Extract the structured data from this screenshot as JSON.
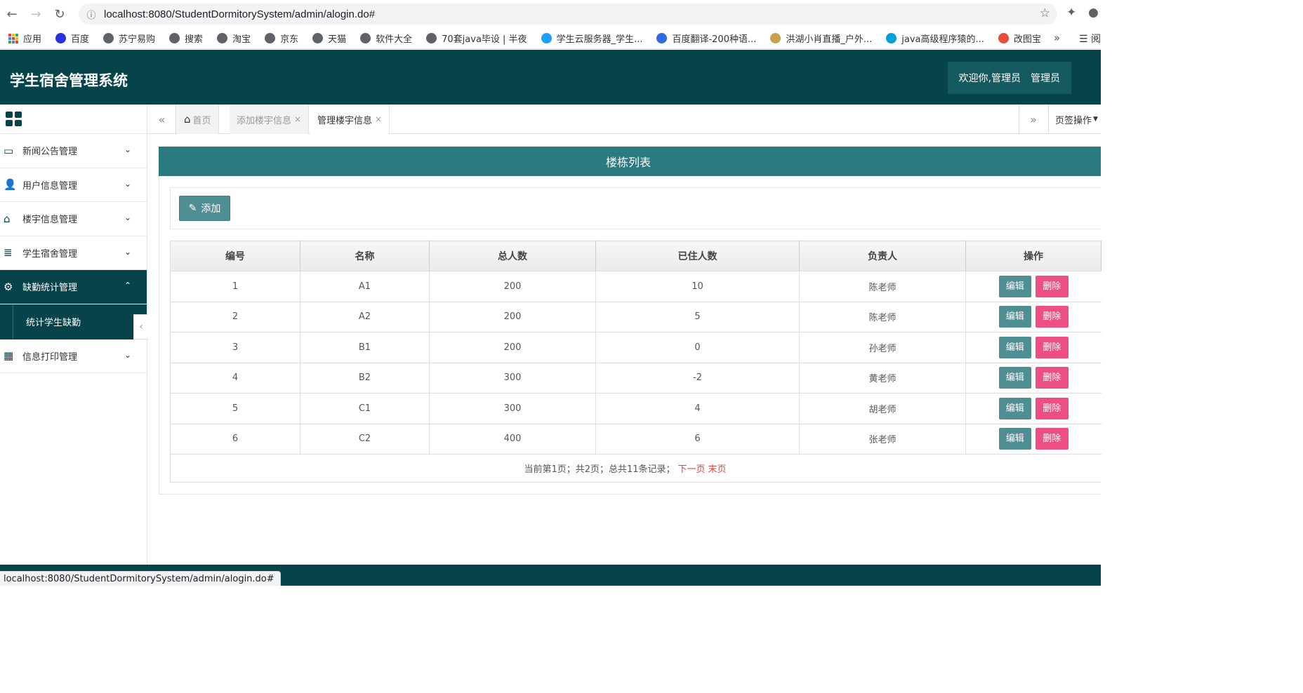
{
  "browser": {
    "url": "localhost:8080/StudentDormitorySystem/admin/alogin.do#",
    "status_url": "localhost:8080/StudentDormitorySystem/admin/alogin.do#",
    "bookmarks": [
      {
        "label": "应用",
        "color": "#4285f4"
      },
      {
        "label": "百度",
        "color": "#2932e1"
      },
      {
        "label": "苏宁易购",
        "color": "#5f6368"
      },
      {
        "label": "搜索",
        "color": "#5f6368"
      },
      {
        "label": "淘宝",
        "color": "#5f6368"
      },
      {
        "label": "京东",
        "color": "#5f6368"
      },
      {
        "label": "天猫",
        "color": "#5f6368"
      },
      {
        "label": "软件大全",
        "color": "#5f6368"
      },
      {
        "label": "70套java毕设 | 半夜",
        "color": "#5f6368"
      },
      {
        "label": "学生云服务器_学生...",
        "color": "#1e9fff"
      },
      {
        "label": "百度翻译-200种语...",
        "color": "#2f6ae0"
      },
      {
        "label": "洪湖小肖直播_户外...",
        "color": "#c8a24a"
      },
      {
        "label": "java高级程序猿的...",
        "color": "#00a1d6"
      },
      {
        "label": "改图宝",
        "color": "#e84c3d"
      }
    ],
    "bookmarks_more": "»",
    "reading_list": "阅"
  },
  "header": {
    "title": "学生宿舍管理系统",
    "welcome": "欢迎你,管理员",
    "role": "管理员"
  },
  "sidebar": {
    "items": [
      {
        "label": "新闻公告管理",
        "icon": "monitor-icon"
      },
      {
        "label": "用户信息管理",
        "icon": "user-icon"
      },
      {
        "label": "楼宇信息管理",
        "icon": "home-icon"
      },
      {
        "label": "学生宿舍管理",
        "icon": "database-icon"
      },
      {
        "label": "缺勤统计管理",
        "icon": "gears-icon"
      },
      {
        "label": "信息打印管理",
        "icon": "film-icon"
      }
    ],
    "active_sub": "统计学生缺勤"
  },
  "tabs": [
    {
      "label": "首页"
    },
    {
      "label": "添加楼宇信息"
    },
    {
      "label": "管理楼宇信息"
    }
  ],
  "tab_ops": "页签操作",
  "panel": {
    "title": "楼栋列表",
    "add_label": "添加"
  },
  "table": {
    "headers": [
      "编号",
      "名称",
      "总人数",
      "已住人数",
      "负责人",
      "操作"
    ],
    "rows": [
      {
        "id": "1",
        "name": "A1",
        "total": "200",
        "occupied": "10",
        "manager": "陈老师"
      },
      {
        "id": "2",
        "name": "A2",
        "total": "200",
        "occupied": "5",
        "manager": "陈老师"
      },
      {
        "id": "3",
        "name": "B1",
        "total": "200",
        "occupied": "0",
        "manager": "孙老师"
      },
      {
        "id": "4",
        "name": "B2",
        "total": "300",
        "occupied": "-2",
        "manager": "黄老师"
      },
      {
        "id": "5",
        "name": "C1",
        "total": "300",
        "occupied": "4",
        "manager": "胡老师"
      },
      {
        "id": "6",
        "name": "C2",
        "total": "400",
        "occupied": "6",
        "manager": "张老师"
      }
    ],
    "edit_label": "编辑",
    "delete_label": "删除"
  },
  "pager": {
    "info": "当前第1页；共2页；总共11条记录；",
    "next": "下一页",
    "last": "末页"
  },
  "colors": {
    "header_bg": "#06434a",
    "panel_title_bg": "#2a7a7f",
    "edit_btn": "#4f8f93",
    "delete_btn": "#ee4f83",
    "pager_link": "#e0433c"
  }
}
